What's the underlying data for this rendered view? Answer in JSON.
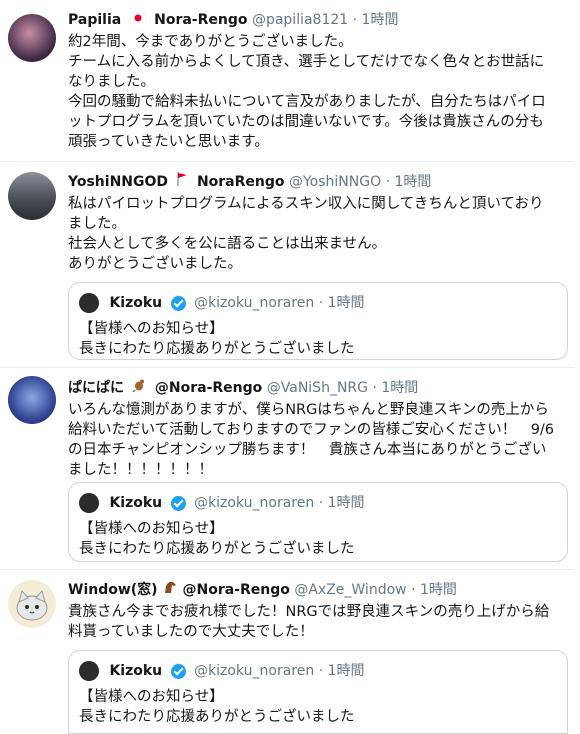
{
  "tweets": [
    {
      "name": "Papilia",
      "name_suffix": "Nora-Rengo",
      "handle": "@papilia8121",
      "dot": "·",
      "time": "1時間",
      "lines": [
        "約2年間、今までありがとうございました。",
        "チームに入る前からよくして頂き、選手としてだけでなく色々とお世話に",
        "なりました。",
        "今回の騒動で給料未払いについて言及がありましたが、自分たちはパイロ",
        "ットプログラムを頂いていたのは間違いないです。今後は貴族さんの分も",
        "頑張っていきたいと思います。"
      ]
    },
    {
      "name": "YoshiNNGOD",
      "name_suffix": "NoraRengo",
      "handle": "@YoshiNNGO",
      "dot": "·",
      "time": "1時間",
      "lines": [
        "私はパイロットプログラムによるスキン収入に関してきちんと頂いており",
        "ました。",
        "社会人として多くを公に語ることは出来ません。",
        "ありがとうございました。"
      ]
    },
    {
      "name": "ぱにぱに",
      "name_suffix": "@Nora-Rengo",
      "handle": "@VaNiSh_NRG",
      "dot": "·",
      "time": "1時間",
      "lines": [
        "いろんな憶測がありますが、僕らNRGはちゃんと野良連スキンの売上から",
        "給料いただいて活動しておりますのでファンの皆様ご安心ください！　9/6",
        "の日本チャンピオンシップ勝ちます！　貴族さん本当にありがとうござい",
        "ました！！！！！！！"
      ]
    },
    {
      "name": "Window(窓)",
      "name_suffix": "@Nora-Rengo",
      "handle": "@AxZe_Window",
      "dot": "·",
      "time": "1時間",
      "lines": [
        "貴族さん今までお疲れ様でした！NRGでは野良連スキンの売り上げから給",
        "料貰っていましたので大丈夫でした！"
      ]
    }
  ],
  "quote": {
    "name": "Kizoku",
    "handle": "@kizoku_noraren",
    "dot": "·",
    "time": "1時間",
    "line1": "【皆様へのお知らせ】",
    "line2": "長きにわたり応援ありがとうございました"
  },
  "colors": {
    "text": "#14171a",
    "muted": "#657786",
    "border": "#e6ecf0",
    "verified": "#1da1f2"
  }
}
